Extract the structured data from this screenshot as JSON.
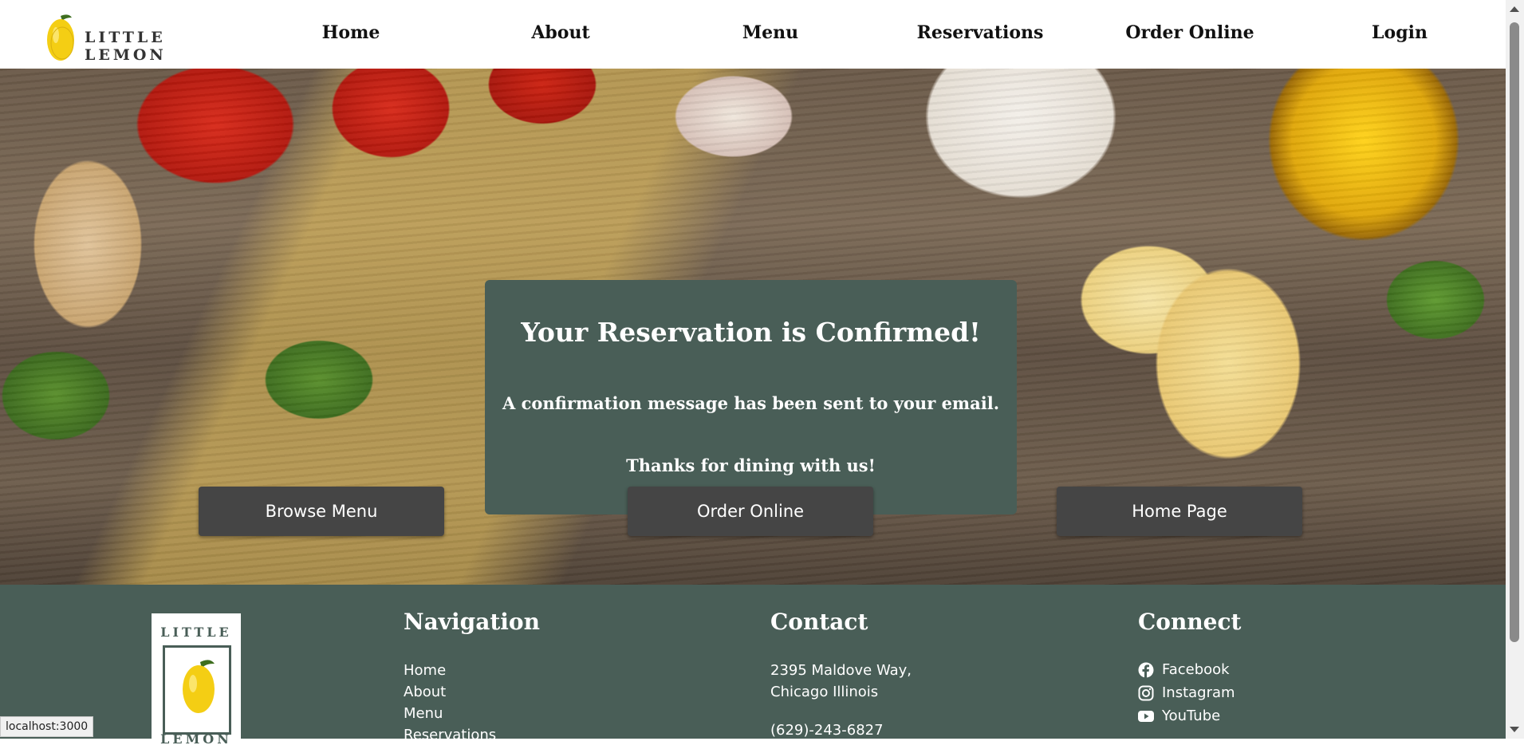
{
  "header": {
    "logo_text": "LITTLE LEMON",
    "nav": [
      {
        "label": "Home"
      },
      {
        "label": "About"
      },
      {
        "label": "Menu"
      },
      {
        "label": "Reservations"
      },
      {
        "label": "Order Online"
      },
      {
        "label": "Login"
      }
    ]
  },
  "confirmation": {
    "title": "Your Reservation is Confirmed!",
    "message": "A confirmation message has been sent to your email.",
    "thanks": "Thanks for dining with us!"
  },
  "actions": [
    {
      "label": "Browse Menu"
    },
    {
      "label": "Order Online"
    },
    {
      "label": "Home Page"
    }
  ],
  "footer": {
    "logo_top": "LITTLE",
    "logo_bottom": "LEMON",
    "navigation": {
      "heading": "Navigation",
      "links": [
        "Home",
        "About",
        "Menu",
        "Reservations"
      ]
    },
    "contact": {
      "heading": "Contact",
      "address_line1": "2395 Maldove Way,",
      "address_line2": "Chicago Illinois",
      "phone": "(629)-243-6827"
    },
    "connect": {
      "heading": "Connect",
      "links": [
        {
          "label": "Facebook",
          "icon": "facebook-icon"
        },
        {
          "label": "Instagram",
          "icon": "instagram-icon"
        },
        {
          "label": "YouTube",
          "icon": "youtube-icon"
        }
      ]
    }
  },
  "status_bar": {
    "url": "localhost:3000"
  },
  "colors": {
    "brand_green": "#495e57",
    "lemon_yellow": "#f4ce14",
    "button_dark": "#454545"
  }
}
